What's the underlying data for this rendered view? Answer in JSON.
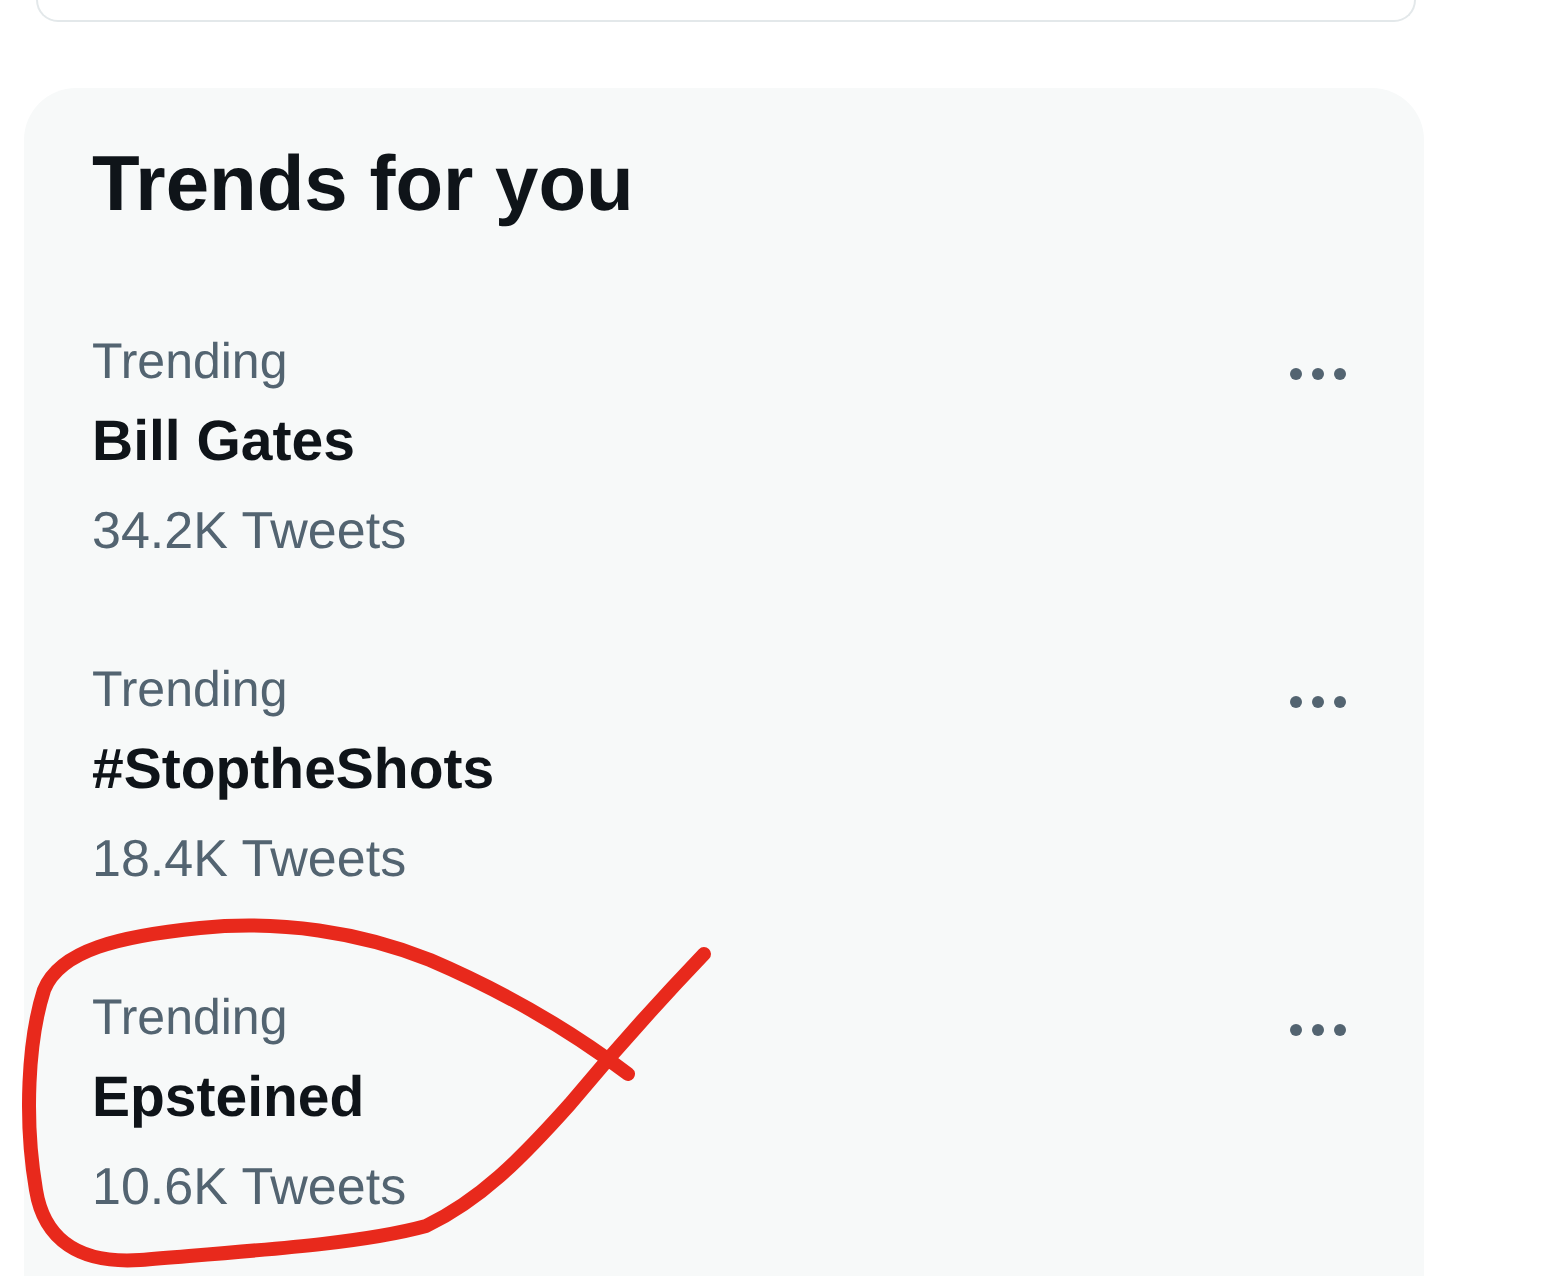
{
  "trends_panel": {
    "title": "Trends for you",
    "trends": [
      {
        "context": "Trending",
        "name": "Bill Gates",
        "count": "34.2K Tweets"
      },
      {
        "context": "Trending",
        "name": "#StoptheShots",
        "count": "18.4K Tweets"
      },
      {
        "context": "Trending",
        "name": "Epsteined",
        "count": "10.6K Tweets"
      }
    ]
  }
}
